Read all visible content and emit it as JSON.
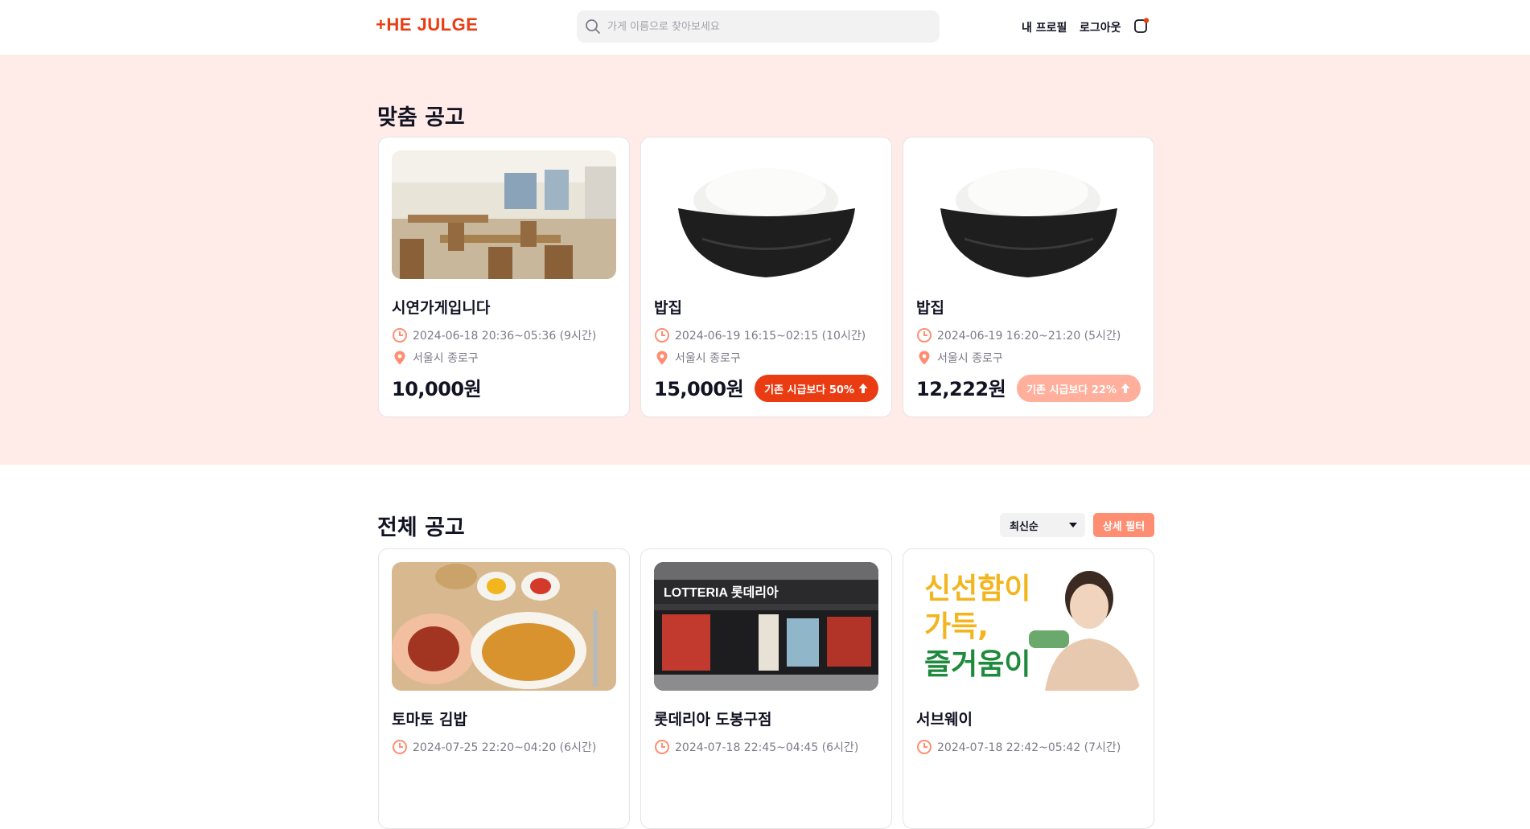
{
  "header": {
    "logo": "+HE JULGE",
    "search_placeholder": "가게 이름으로 찾아보세요",
    "profile_link": "내 프로필",
    "logout_link": "로그아웃"
  },
  "custom_section": {
    "title": "맞춤 공고",
    "cards": [
      {
        "name": "시연가게입니다",
        "time": "2024-06-18 20:36~05:36 (9시간)",
        "location": "서울시 종로구",
        "wage": "10,000원",
        "image": "restaurant-interior-photo",
        "badge": ""
      },
      {
        "name": "밥집",
        "time": "2024-06-19 16:15~02:15 (10시간)",
        "location": "서울시 종로구",
        "wage": "15,000원",
        "image": "rice-bowl-photo",
        "badge": "기존 시급보다 50%"
      },
      {
        "name": "밥집",
        "time": "2024-06-19 16:20~21:20 (5시간)",
        "location": "서울시 종로구",
        "wage": "12,222원",
        "image": "rice-bowl-photo",
        "badge": "기존 시급보다 22%"
      }
    ]
  },
  "all_section": {
    "title": "전체 공고",
    "sort_selected": "최신순",
    "filter_button": "상세 필터",
    "cards": [
      {
        "name": "토마토 김밥",
        "time": "2024-07-25 22:20~04:20 (6시간)",
        "image": "kimbap-meal-photo"
      },
      {
        "name": "롯데리아 도봉구점",
        "time": "2024-07-18 22:45~04:45 (6시간)",
        "image": "lotteria-storefront-photo",
        "sign": "LOTTERIA  롯데리아"
      },
      {
        "name": "서브웨이",
        "time": "2024-07-18 22:42~05:42 (7시간)",
        "image": "subway-ad-photo",
        "ad_text": [
          "신선함이",
          "가득,",
          "즐거움이"
        ]
      }
    ]
  },
  "colors": {
    "brand": "#ea3c12",
    "section_bg": "#ffebe7",
    "badge_strong": "#ea3c12",
    "badge_light": "#ffaf9b",
    "filter_button": "#ff8d72"
  }
}
